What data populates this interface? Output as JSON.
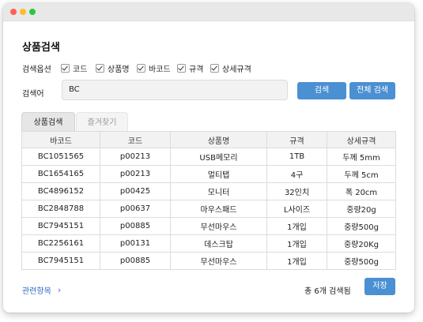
{
  "window": {
    "title_dots": [
      "close",
      "minimize",
      "maximize"
    ]
  },
  "page": {
    "title": "상품검색"
  },
  "options": {
    "label": "검색옵션",
    "checkboxes": [
      {
        "label": "코드",
        "checked": true
      },
      {
        "label": "상품명",
        "checked": true
      },
      {
        "label": "바코드",
        "checked": true
      },
      {
        "label": "규격",
        "checked": true
      },
      {
        "label": "상세규격",
        "checked": true
      }
    ]
  },
  "search": {
    "label": "검색어",
    "value": "BC",
    "search_button": "검색",
    "search_all_button": "전체 검색"
  },
  "tabs": [
    {
      "label": "상품검색",
      "active": true
    },
    {
      "label": "즐겨찾기",
      "active": false
    }
  ],
  "table": {
    "headers": [
      "바코드",
      "코드",
      "상품명",
      "규격",
      "상세규격"
    ],
    "rows": [
      [
        "BC1051565",
        "p00213",
        "USB메모리",
        "1TB",
        "두께 5mm"
      ],
      [
        "BC1654165",
        "p00213",
        "멀티탭",
        "4구",
        "두께 5cm"
      ],
      [
        "BC4896152",
        "p00425",
        "모니터",
        "32인치",
        "폭 20cm"
      ],
      [
        "BC2848788",
        "p00637",
        "마우스패드",
        "L사이즈",
        "중량20g"
      ],
      [
        "BC7945151",
        "p00885",
        "무선마우스",
        "1개입",
        "중량500g"
      ],
      [
        "BC2256161",
        "p00131",
        "데스크탑",
        "1개입",
        "중량20Kg"
      ],
      [
        "BC7945151",
        "p00885",
        "무선마우스",
        "1개입",
        "중량500g"
      ]
    ]
  },
  "footer": {
    "related_link": "관련항목",
    "chevron_icon": "chevron-right-icon",
    "result_count": "총 6개 검색됨",
    "save_button": "저장"
  },
  "colors": {
    "accent": "#4a90d2",
    "link": "#2f6fc0"
  }
}
